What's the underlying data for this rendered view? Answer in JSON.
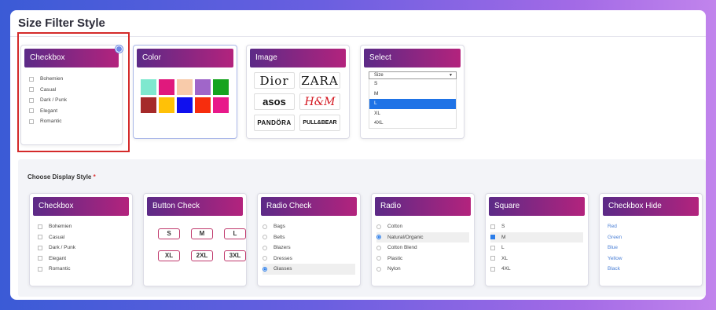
{
  "page": {
    "title": "Size Filter Style"
  },
  "top_cards": {
    "checkbox": {
      "header": "Checkbox",
      "items": [
        "Bohemien",
        "Casual",
        "Dark / Punk",
        "Elegant",
        "Romantic"
      ]
    },
    "color": {
      "header": "Color",
      "swatches": [
        "#7fe8cf",
        "#e0197d",
        "#f8cbaa",
        "#a066c9",
        "#16a31f",
        "#a52a2a",
        "#ffc107",
        "#1010ee",
        "#f72d0d",
        "#e8198a"
      ]
    },
    "image": {
      "header": "Image",
      "brands": [
        "Dior",
        "ZARA",
        "asos",
        "H&M",
        "PANDÖRA",
        "PULL&BEAR"
      ]
    },
    "select": {
      "header": "Select",
      "value": "Size",
      "options": [
        "S",
        "M",
        "L",
        "XL",
        "4XL"
      ],
      "selected": "L"
    }
  },
  "choose": {
    "label": "Choose Display Style",
    "required": "*"
  },
  "styles": {
    "checkbox": {
      "header": "Checkbox",
      "items": [
        "Bohemien",
        "Casual",
        "Dark / Punk",
        "Elegant",
        "Romantic"
      ]
    },
    "button_check": {
      "header": "Button Check",
      "sizes": [
        "S",
        "M",
        "L",
        "XL",
        "2XL",
        "3XL"
      ]
    },
    "radio_check": {
      "header": "Radio Check",
      "items": [
        "Bags",
        "Belts",
        "Blazers",
        "Dresses",
        "Glasses"
      ],
      "selected": "Glasses"
    },
    "radio": {
      "header": "Radio",
      "items": [
        "Cotton",
        "Natural/Organic",
        "Cotton Blend",
        "Plastic",
        "Nylon"
      ],
      "selected": "Natural/Organic"
    },
    "square": {
      "header": "Square",
      "items": [
        "S",
        "M",
        "L",
        "XL",
        "4XL"
      ],
      "selected": "M"
    },
    "checkbox_hide": {
      "header": "Checkbox Hide",
      "items": [
        "Red",
        "Green",
        "Blue",
        "Yellow",
        "Black"
      ]
    }
  }
}
